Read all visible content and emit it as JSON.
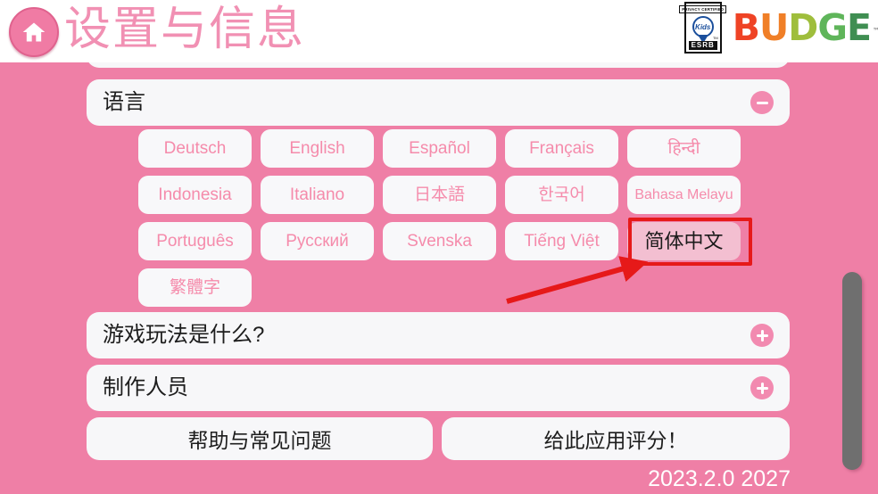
{
  "header": {
    "title": "设置与信息",
    "home_icon": "home-icon",
    "esrb": {
      "top_text": "PRIVACY CERTIFIED",
      "seal_text": "Kids",
      "bottom_text": "ESRB",
      "tm": "TM"
    },
    "budge": {
      "letters": [
        {
          "char": "B",
          "color": "#ef4325"
        },
        {
          "char": "U",
          "color": "#f07f27"
        },
        {
          "char": "D",
          "color": "#9fbe3c"
        },
        {
          "char": "G",
          "color": "#5fb55a"
        },
        {
          "char": "E",
          "color": "#3f8e52"
        }
      ],
      "tm": "™"
    }
  },
  "colors": {
    "background_pink": "#ef7fa6",
    "card_white": "#f7f7f9",
    "accent_pink": "#f28ab0",
    "lang_text_pink": "#f58bab",
    "selected_bg": "#f3bfd1",
    "annotation_red": "#e61919",
    "scrollbar_gray": "#6f6f6f"
  },
  "sections": {
    "language": {
      "label": "语言",
      "toggle_icon": "minus-circle-icon",
      "expanded": true,
      "options": [
        {
          "label": "Deutsch",
          "selected": false
        },
        {
          "label": "English",
          "selected": false
        },
        {
          "label": "Español",
          "selected": false
        },
        {
          "label": "Français",
          "selected": false
        },
        {
          "label": "हिन्दी",
          "selected": false
        },
        {
          "label": "Indonesia",
          "selected": false
        },
        {
          "label": "Italiano",
          "selected": false
        },
        {
          "label": "日本語",
          "selected": false
        },
        {
          "label": "한국어",
          "selected": false
        },
        {
          "label": "Bahasa Melayu",
          "selected": false
        },
        {
          "label": "Português",
          "selected": false
        },
        {
          "label": "Русский",
          "selected": false
        },
        {
          "label": "Svenska",
          "selected": false
        },
        {
          "label": "Tiếng Việt",
          "selected": false
        },
        {
          "label": "简体中文",
          "selected": true
        },
        {
          "label": "繁體字",
          "selected": false
        }
      ]
    },
    "gameplay": {
      "label": "游戏玩法是什么?",
      "toggle_icon": "plus-circle-icon",
      "expanded": false
    },
    "credits": {
      "label": "制作人员",
      "toggle_icon": "plus-circle-icon",
      "expanded": false
    }
  },
  "footer": {
    "help_button": "帮助与常见问题",
    "rate_button": "给此应用评分！",
    "version": "2023.2.0 2027"
  },
  "scrollbar": {
    "thumb_position_percent": 52
  }
}
